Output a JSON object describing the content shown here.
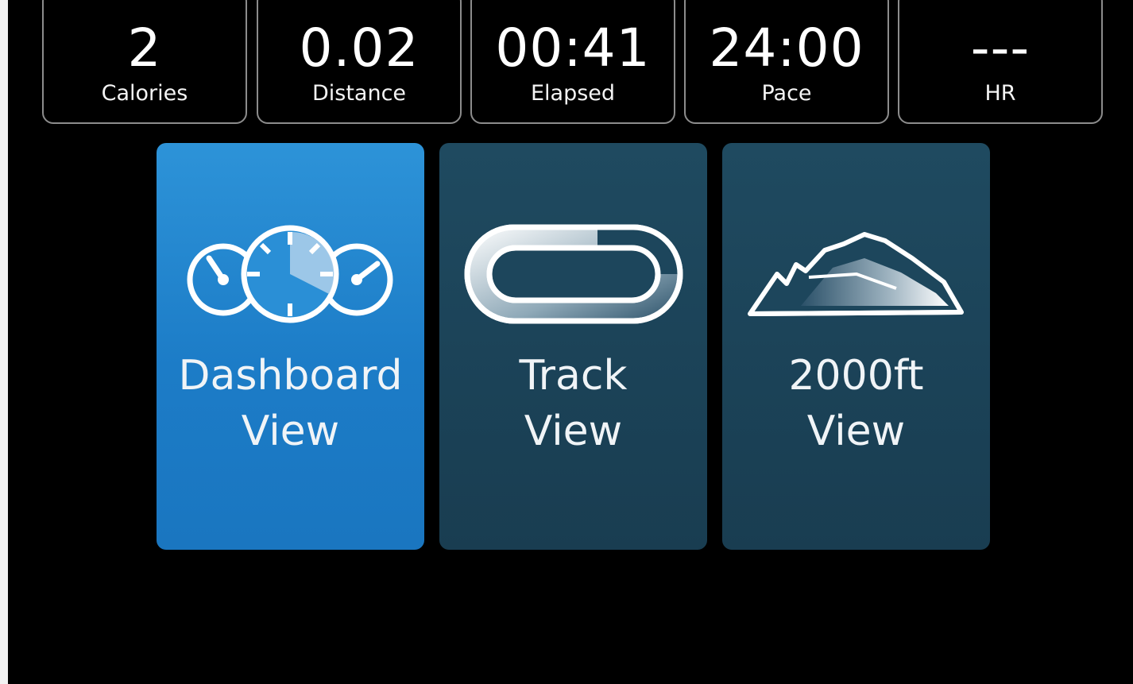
{
  "stats": [
    {
      "value": "2",
      "label": "Calories"
    },
    {
      "value": "0.02",
      "label": "Distance"
    },
    {
      "value": "00:41",
      "label": "Elapsed"
    },
    {
      "value": "24:00",
      "label": "Pace"
    },
    {
      "value": "---",
      "label": "HR"
    }
  ],
  "views": [
    {
      "line1": "Dashboard",
      "line2": "View",
      "icon": "dashboard-gauges-icon",
      "selected": true
    },
    {
      "line1": "Track",
      "line2": "View",
      "icon": "oval-track-icon",
      "selected": false
    },
    {
      "line1": "2000ft",
      "line2": "View",
      "icon": "mountain-terrain-icon",
      "selected": false
    }
  ],
  "colors": {
    "active_tile": "#2a8fd6",
    "inactive_tile": "#1d465c",
    "stat_border": "#8c8c8c",
    "background": "#000000"
  }
}
